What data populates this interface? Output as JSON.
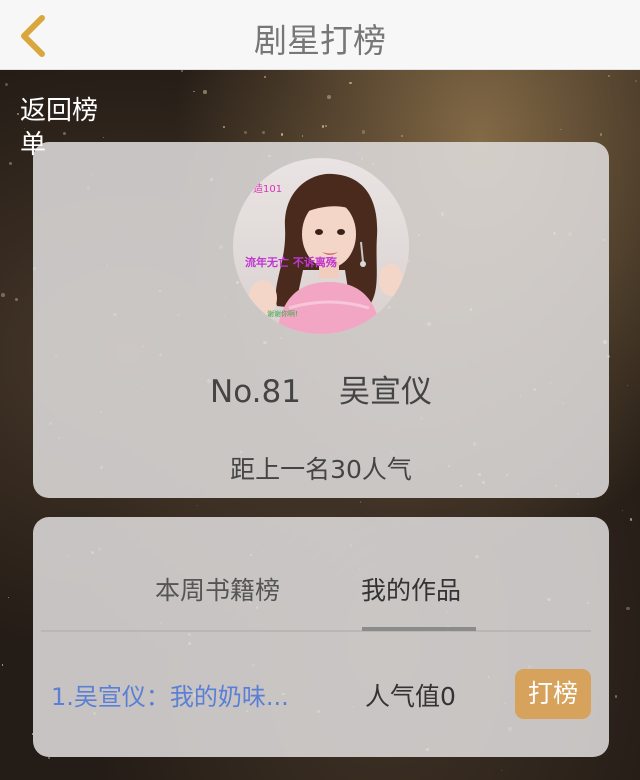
{
  "navbar": {
    "title": "剧星打榜",
    "back_icon": "chevron-left-icon",
    "accent_color": "#d9a73c"
  },
  "back_link": {
    "label": "返回榜单"
  },
  "profile": {
    "rank": "No.81",
    "name": "吴宣仪",
    "gap_text": "距上一名30人气",
    "avatar_texts": {
      "top": "造101",
      "middle": "流年无亡 不诉离殇",
      "bottom": "谢谢你啊!"
    }
  },
  "tabs": [
    {
      "label": "本周书籍榜",
      "active": false
    },
    {
      "label": "我的作品",
      "active": true
    }
  ],
  "works": [
    {
      "title": "1.吴宣仪：我的奶味...",
      "popularity": "人气值0",
      "action_label": "打榜"
    }
  ],
  "colors": {
    "link_blue": "#5a7fd6",
    "button_gold": "#d6a25c"
  }
}
